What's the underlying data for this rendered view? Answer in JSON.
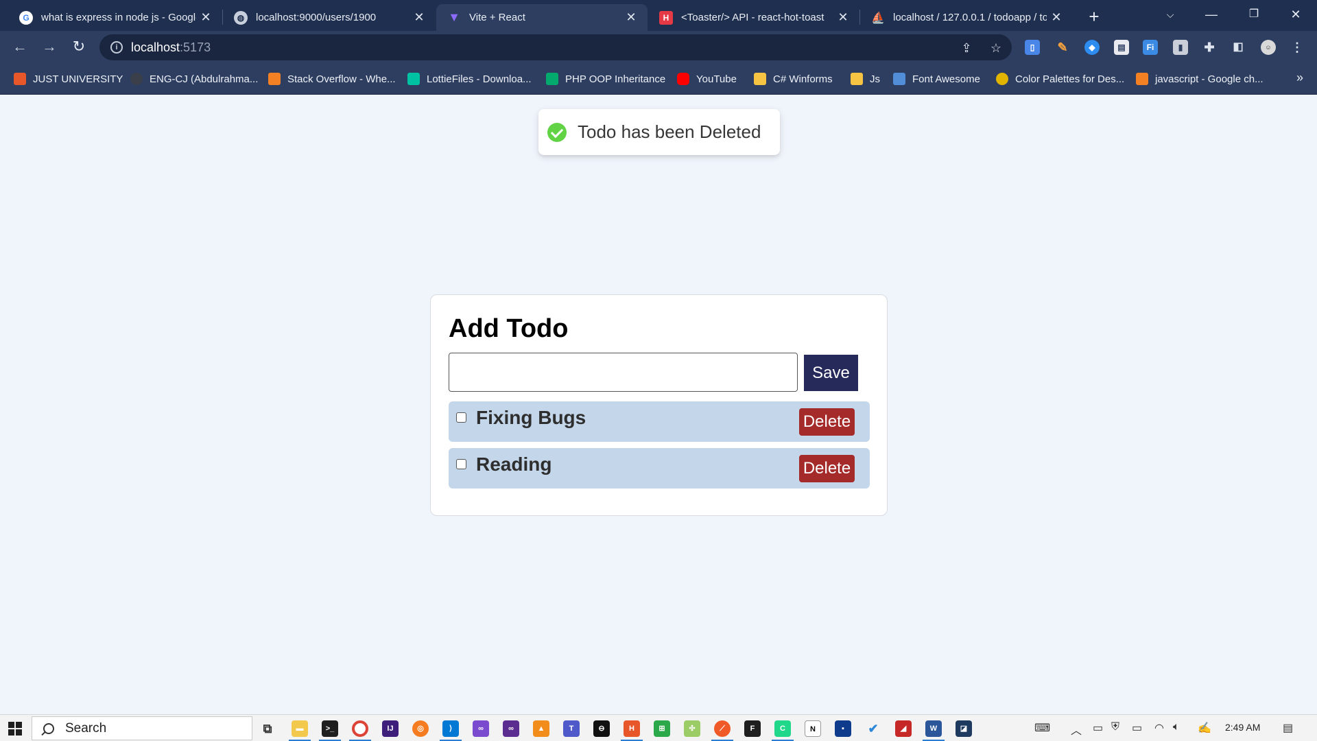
{
  "browser": {
    "tabs": [
      {
        "title": "what is express in node js - Google",
        "icon": "google-icon",
        "color": "#ffffff",
        "active": false
      },
      {
        "title": "localhost:9000/users/1900",
        "icon": "globe-icon",
        "color": "#c8cfdc",
        "active": false
      },
      {
        "title": "Vite + React",
        "icon": "vite-icon",
        "color": "#8c6cff",
        "active": true
      },
      {
        "title": "<Toaster/> API - react-hot-toast",
        "icon": "react-hot-toast-icon",
        "color": "#e63946",
        "active": false
      },
      {
        "title": "localhost / 127.0.0.1 / todoapp / to",
        "icon": "phpmyadmin-icon",
        "color": "#f0a030",
        "active": false
      }
    ],
    "address": {
      "host": "localhost",
      "port": ":5173"
    },
    "bookmarks": [
      {
        "label": "JUST UNIVERSITY",
        "color": "#e8572a"
      },
      {
        "label": "ENG-CJ (Abdulrahma...",
        "color": "#3a3f4a"
      },
      {
        "label": "Stack Overflow - Whe...",
        "color": "#f48024"
      },
      {
        "label": "LottieFiles - Downloa...",
        "color": "#00c1a2"
      },
      {
        "label": "PHP OOP Inheritance",
        "color": "#04aa6d"
      },
      {
        "label": "YouTube",
        "color": "#ff0000"
      },
      {
        "label": "C# Winforms",
        "color": "#f6c343"
      },
      {
        "label": "Js",
        "color": "#f6c343"
      },
      {
        "label": "Font Awesome",
        "color": "#528dd7"
      },
      {
        "label": "Color Palettes for Des...",
        "color": "#e0b400"
      },
      {
        "label": "javascript - Google ch...",
        "color": "#f48024"
      }
    ]
  },
  "toast": {
    "message": "Todo has been Deleted",
    "status_color": "#61d345"
  },
  "todo": {
    "heading": "Add Todo",
    "input_value": "",
    "save_label": "Save",
    "delete_label": "Delete",
    "items": [
      {
        "text": "Fixing Bugs",
        "checked": false
      },
      {
        "text": "Reading",
        "checked": false
      }
    ]
  },
  "taskbar": {
    "search_placeholder": "Search",
    "time": "2:49 AM"
  }
}
